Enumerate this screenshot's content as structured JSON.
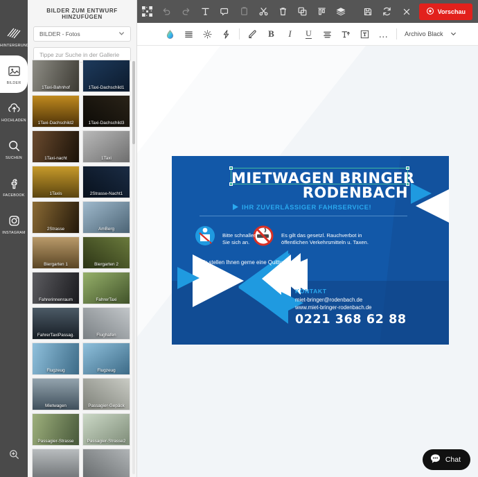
{
  "sidebar": {
    "items": [
      {
        "label": "HINTERGRUND",
        "icon": "stripes-icon",
        "active": false
      },
      {
        "label": "BILDER",
        "icon": "image-icon",
        "active": true
      },
      {
        "label": "HOCHLADEN",
        "icon": "upload-cloud-icon",
        "active": false
      },
      {
        "label": "SUCHEN",
        "icon": "search-icon",
        "active": false
      },
      {
        "label": "FACEBOOK",
        "icon": "facebook-icon",
        "active": false
      },
      {
        "label": "INSTAGRAM",
        "icon": "instagram-icon",
        "active": false
      }
    ],
    "zoom_icon": "zoom-in-icon"
  },
  "panel": {
    "title": "BILDER ZUM ENTWURF HINZUFÜGEN",
    "category_value": "BILDER - Fotos",
    "search_placeholder": "Tippe zur Suche in der Gallerie",
    "thumbnails": [
      {
        "label": "1Taxi-Bahnhof",
        "tone": "#8e8d85",
        "tone2": "#3c3a33"
      },
      {
        "label": "1Taxi-Dachschild1",
        "tone": "#1d3a5c",
        "tone2": "#0c1a2c"
      },
      {
        "label": "1Taxi-Dachschild2",
        "tone": "#c08a1e",
        "tone2": "#4a3008"
      },
      {
        "label": "1Taxi-Dachschild3",
        "tone": "#2a2318",
        "tone2": "#0c0a06"
      },
      {
        "label": "1Taxi-nacht",
        "tone": "#6a4a2e",
        "tone2": "#1a1208"
      },
      {
        "label": "1Taxi",
        "tone": "#b9b9b9",
        "tone2": "#6e6e6e"
      },
      {
        "label": "1Taxis",
        "tone": "#c79a2a",
        "tone2": "#5a4410"
      },
      {
        "label": "2Strasse-Nacht1",
        "tone": "#1b2c44",
        "tone2": "#07101c"
      },
      {
        "label": "2Strasse",
        "tone": "#8a6a34",
        "tone2": "#23180a"
      },
      {
        "label": "AmBerg",
        "tone": "#9fb9cc",
        "tone2": "#4c6475"
      },
      {
        "label": "Biergarten 1",
        "tone": "#b99a6a",
        "tone2": "#5a4524"
      },
      {
        "label": "Biergarten 2",
        "tone": "#6a7a3c",
        "tone2": "#2c3415"
      },
      {
        "label": "Fahrerinnenraum",
        "tone": "#5c5c60",
        "tone2": "#1a1a1e"
      },
      {
        "label": "FahrerTaxi",
        "tone": "#96b06a",
        "tone2": "#41532a"
      },
      {
        "label": "FahrerTaxiPassag.",
        "tone": "#4c5a66",
        "tone2": "#161d24"
      },
      {
        "label": "Flughafen",
        "tone": "#c2c6c9",
        "tone2": "#7a8084"
      },
      {
        "label": "Flugzeug",
        "tone": "#8fc0dc",
        "tone2": "#3d6b87"
      },
      {
        "label": "Flugzeug",
        "tone": "#8fc0dc",
        "tone2": "#3d6b87"
      },
      {
        "label": "Mietwagen",
        "tone": "#93a3ad",
        "tone2": "#40505c"
      },
      {
        "label": "Passagier-Gepäck",
        "tone": "#c9cbc4",
        "tone2": "#7d8078"
      },
      {
        "label": "Passagier-Strasse",
        "tone": "#9eb07c",
        "tone2": "#47583a"
      },
      {
        "label": "Passagier-Strasse2",
        "tone": "#cbd8c6",
        "tone2": "#7e8c78"
      },
      {
        "label": "",
        "tone": "#b8bcbe",
        "tone2": "#6c7073"
      },
      {
        "label": "",
        "tone": "#b0b4b6",
        "tone2": "#65696b"
      }
    ]
  },
  "toolbar_top": {
    "buttons": [
      {
        "name": "qr-marker-icon",
        "dim": false
      },
      {
        "name": "undo-icon",
        "dim": true
      },
      {
        "name": "redo-icon",
        "dim": true
      },
      {
        "name": "text-icon",
        "dim": false
      },
      {
        "name": "shape-icon",
        "dim": false
      },
      {
        "name": "paste-icon",
        "dim": true
      },
      {
        "name": "scissors-icon",
        "dim": false
      },
      {
        "name": "trash-icon",
        "dim": false
      },
      {
        "name": "duplicate-icon",
        "dim": false
      },
      {
        "name": "align-top-icon",
        "dim": false
      },
      {
        "name": "layers-icon",
        "dim": false
      }
    ],
    "right_buttons": [
      {
        "name": "save-icon"
      },
      {
        "name": "refresh-icon"
      },
      {
        "name": "close-icon"
      }
    ],
    "preview_label": "Vorschau",
    "preview_icon": "eye-target-icon",
    "preview_color": "#e2211c"
  },
  "toolbar_format": {
    "buttons": [
      {
        "name": "color-drop-icon"
      },
      {
        "name": "list-lines-icon"
      },
      {
        "name": "brightness-icon"
      },
      {
        "name": "effects-bolt-icon"
      }
    ],
    "buttons2": [
      {
        "name": "pen-icon"
      },
      {
        "name": "bold-icon",
        "glyph": "B"
      },
      {
        "name": "italic-icon",
        "glyph": "I"
      },
      {
        "name": "underline-icon",
        "glyph": "U"
      },
      {
        "name": "align-icon"
      },
      {
        "name": "text-size-icon"
      },
      {
        "name": "text-box-icon"
      },
      {
        "name": "more-icon",
        "glyph": "…"
      }
    ],
    "font_value": "Archivo Black"
  },
  "canvas": {
    "flyer": {
      "title_line1": "MIETWAGEN BRINGER",
      "title_line2": "RODENBACH",
      "subtitle": "IHR ZUVERLÄSSIGER FAHRSERVICE!",
      "note_seatbelt": "Bitte schnallen\nSie sich an.",
      "note_smoking": "Es gilt das gesetzl. Rauchverbot in\nöffentlichen Verkehrsmitteln u. Taxen.",
      "note_receipt": "1. Wir stellen Ihnen gerne eine Quittung aus.",
      "contact_heading": "KONTAKT",
      "email": "miet-bringer@rodenbach.de",
      "website": "www.miet-bringer-rodenbach.de",
      "phone": "0221 368 62 88",
      "bg_color": "#1258a8",
      "accent_color": "#2aa9ef",
      "dark_color": "#123a70",
      "selection_color": "#3fb9a0"
    }
  },
  "chat": {
    "label": "Chat",
    "icon": "chat-bubble-icon"
  }
}
